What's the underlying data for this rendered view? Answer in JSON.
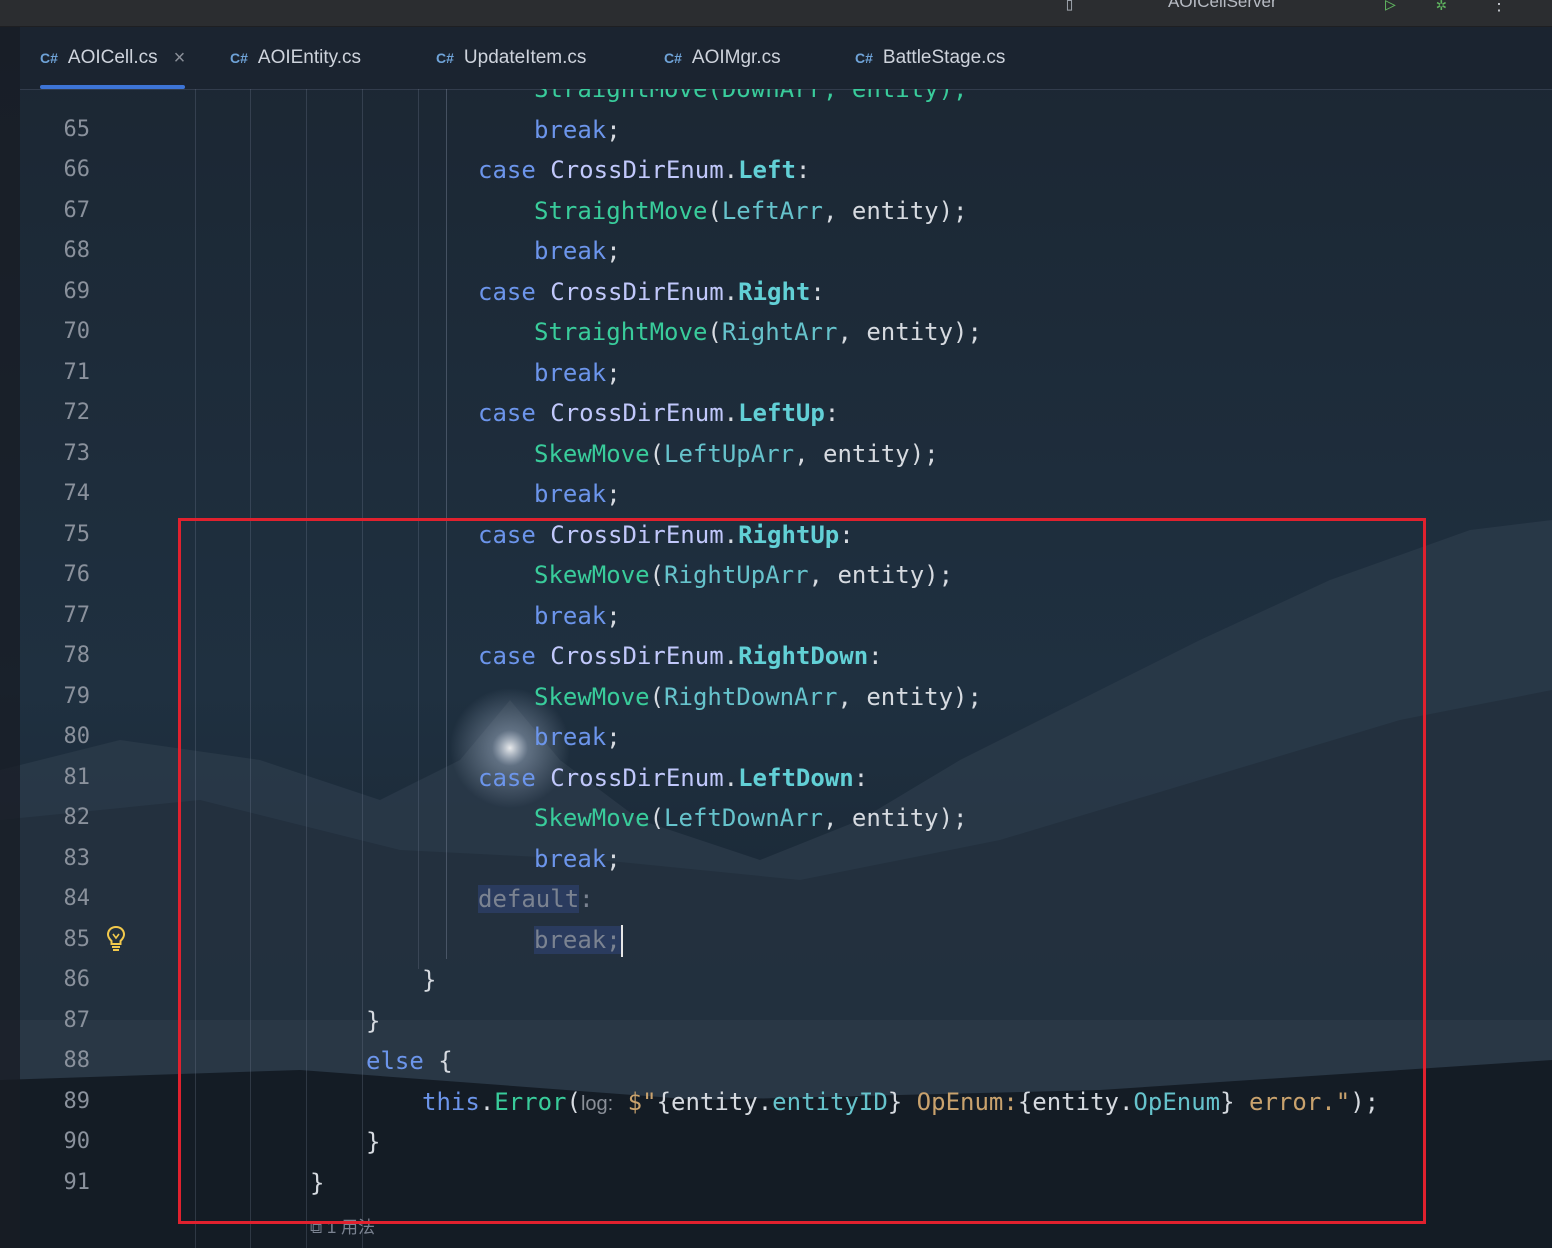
{
  "topbar": {
    "run_config": "AOICellServer",
    "run_icon": "play-icon",
    "debug_icon": "bug-icon",
    "more_icon": "more-vertical-icon"
  },
  "tabs": [
    {
      "lang": "C#",
      "label": "AOICell.cs",
      "active": true,
      "closable": true
    },
    {
      "lang": "C#",
      "label": "AOIEntity.cs",
      "active": false
    },
    {
      "lang": "C#",
      "label": "UpdateItem.cs",
      "active": false
    },
    {
      "lang": "C#",
      "label": "AOIMgr.cs",
      "active": false
    },
    {
      "lang": "C#",
      "label": "BattleStage.cs",
      "active": false
    }
  ],
  "editor": {
    "partial_line_top": "StraightMove(DownArr, entity);",
    "lines": [
      {
        "n": "65"
      },
      {
        "n": "66"
      },
      {
        "n": "67"
      },
      {
        "n": "68"
      },
      {
        "n": "69"
      },
      {
        "n": "70"
      },
      {
        "n": "71"
      },
      {
        "n": "72"
      },
      {
        "n": "73"
      },
      {
        "n": "74"
      },
      {
        "n": "75"
      },
      {
        "n": "76"
      },
      {
        "n": "77"
      },
      {
        "n": "78"
      },
      {
        "n": "79"
      },
      {
        "n": "80"
      },
      {
        "n": "81"
      },
      {
        "n": "82"
      },
      {
        "n": "83"
      },
      {
        "n": "84"
      },
      {
        "n": "85"
      },
      {
        "n": "86"
      },
      {
        "n": "87"
      },
      {
        "n": "88"
      },
      {
        "n": "89"
      },
      {
        "n": "90"
      },
      {
        "n": "91"
      }
    ],
    "tokens": {
      "case": "case",
      "break": "break",
      "default": "default",
      "else": "else",
      "this": "this",
      "enum_type": "CrossDirEnum",
      "left": "Left",
      "right": "Right",
      "left_up": "LeftUp",
      "right_up": "RightUp",
      "right_down": "RightDown",
      "left_down": "LeftDown",
      "straight_move": "StraightMove",
      "skew_move": "SkewMove",
      "left_arr": "LeftArr",
      "right_arr": "RightArr",
      "left_up_arr": "LeftUpArr",
      "right_up_arr": "RightUpArr",
      "right_down_arr": "RightDownArr",
      "left_down_arr": "LeftDownArr",
      "entity": "entity",
      "error_method": "Error",
      "log_hint": "log:",
      "entity_id": "entityID",
      "op_enum": "OpEnum",
      "str_prefix": "$\"",
      "str_openum": " OpEnum:",
      "str_error": " error.",
      "str_close": "\""
    },
    "usages_hint": "1 用法",
    "intention_icon": "lightbulb-icon"
  }
}
